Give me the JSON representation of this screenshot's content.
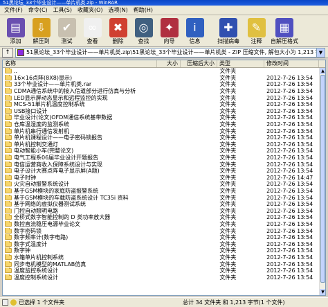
{
  "window": {
    "title": "51黑论坛_33个毕业设计——单片机类.zip - WinRAR"
  },
  "menu": [
    "文件(F)",
    "命令(C)",
    "工具(S)",
    "收藏夹(O)",
    "选项(N)",
    "帮助(H)"
  ],
  "toolbar": [
    {
      "label": "添加",
      "icon": "add-books-icon",
      "color": "#6a4fb0"
    },
    {
      "label": "解压到",
      "icon": "extract-to-icon",
      "color": "#d8a020"
    },
    {
      "label": "测试",
      "icon": "test-check-icon",
      "color": "#c8c0b0"
    },
    {
      "label": "查看",
      "icon": "view-glasses-icon",
      "color": "#f0f0f0"
    },
    {
      "label": "删除",
      "icon": "delete-icon",
      "color": "#d04030"
    },
    {
      "label": "查找",
      "icon": "find-binoculars-icon",
      "color": "#406080"
    },
    {
      "label": "向导",
      "icon": "wizard-icon",
      "color": "#b03040"
    },
    {
      "label": "信息",
      "icon": "info-icon",
      "color": "#3060c0"
    },
    {
      "label": "扫描病毒",
      "icon": "virus-scan-icon",
      "color": "#3050b0"
    },
    {
      "label": "注释",
      "icon": "comment-icon",
      "color": "#e0c040"
    },
    {
      "label": "自解压格式",
      "icon": "sfx-icon",
      "color": "#5050c0"
    }
  ],
  "address": {
    "up_label": "↑",
    "path": "51黑论坛_33个毕业设计——单片机类.zip\\51黑论坛_33个毕业设计——单片机类 - ZIP 压缩文件, 解包大小为 1,213 字节"
  },
  "columns": {
    "name": "名称",
    "size": "大小",
    "packed": "压缩后大小",
    "type": "类型",
    "modified": "修改时间"
  },
  "files": [
    {
      "name": "..",
      "type": "文件夹",
      "modified": ""
    },
    {
      "name": "16×16点阵(8X8)显示)",
      "type": "文件夹",
      "modified": "2012-7-26 13:54"
    },
    {
      "name": "33个毕业设计——单片机类.rar",
      "type": "文件夹",
      "modified": "2012-7-26 13:54"
    },
    {
      "name": "CDMA通信系统中的接入信道部分进行仿真与分析",
      "type": "文件夹",
      "modified": "2012-7-26 13:54"
    },
    {
      "name": "LED显示屏动态显示和远程监控的实现",
      "type": "文件夹",
      "modified": "2012-7-26 13:54"
    },
    {
      "name": "MCS-51单片机温度控制系统",
      "type": "文件夹",
      "modified": "2012-7-26 13:54"
    },
    {
      "name": "USB接口设计",
      "type": "文件夹",
      "modified": "2012-7-26 13:54"
    },
    {
      "name": "毕业设计(论文)OFDM通信系统基带数据",
      "type": "文件夹",
      "modified": "2012-7-26 13:54"
    },
    {
      "name": "仓库温湿度的监测系统",
      "type": "文件夹",
      "modified": "2012-7-26 13:54"
    },
    {
      "name": "单片机串行通信发射机",
      "type": "文件夹",
      "modified": "2012-7-26 13:54"
    },
    {
      "name": "单片机课程设计——电子密码锁报告",
      "type": "文件夹",
      "modified": "2012-7-26 13:54"
    },
    {
      "name": "单片机控制交通灯",
      "type": "文件夹",
      "modified": "2012-7-26 13:54"
    },
    {
      "name": "电动智能小车(完整论文)",
      "type": "文件夹",
      "modified": "2012-7-26 13:54"
    },
    {
      "name": "电气工程系06届毕业设计开题报告",
      "type": "文件夹",
      "modified": "2012-7-26 13:54"
    },
    {
      "name": "电信运营商收入保障系统设计与实现",
      "type": "文件夹",
      "modified": "2012-7-26 13:54"
    },
    {
      "name": "电子设计大赛点阵电子显示屏(A题)",
      "type": "文件夹",
      "modified": "2012-7-26 13:54"
    },
    {
      "name": "电子时钟",
      "type": "文件夹",
      "modified": "2012-7-26 14:47"
    },
    {
      "name": "火灾自动报警系统设计",
      "type": "文件夹",
      "modified": "2012-7-26 13:54"
    },
    {
      "name": "基于GSM模块的家庭防盗报警系统",
      "type": "文件夹",
      "modified": "2012-7-26 13:54"
    },
    {
      "name": "基于GSM模块的车载防盗系统设计 TC35i 资料",
      "type": "文件夹",
      "modified": "2012-7-26 13:54"
    },
    {
      "name": "基于网络的虚拟仪器测试系统",
      "type": "文件夹",
      "modified": "2012-7-26 13:54"
    },
    {
      "name": "门控自动照明电路",
      "type": "文件夹",
      "modified": "2012-7-26 13:54"
    },
    {
      "name": "全桥式数字智能控制的 D 类功率放大器",
      "type": "文件夹",
      "modified": "2012-7-26 13:54"
    },
    {
      "name": "数控直流稳压电源毕业论文",
      "type": "文件夹",
      "modified": "2012-7-26 13:54"
    },
    {
      "name": "数字密码锁",
      "type": "文件夹",
      "modified": "2012-7-26 13:54"
    },
    {
      "name": "数字频率计(数字电路)",
      "type": "文件夹",
      "modified": "2012-7-26 13:54"
    },
    {
      "name": "数字式温度计",
      "type": "文件夹",
      "modified": "2012-7-26 13:54"
    },
    {
      "name": "数字钟",
      "type": "文件夹",
      "modified": "2012-7-26 13:54"
    },
    {
      "name": "水箱单片机控制系统",
      "type": "文件夹",
      "modified": "2012-7-26 13:54"
    },
    {
      "name": "同步电机模型的MATLAB仿真",
      "type": "文件夹",
      "modified": "2012-7-26 13:54"
    },
    {
      "name": "温度监控系统设计",
      "type": "文件夹",
      "modified": "2012-7-26 13:54"
    },
    {
      "name": "温度控制系统设计",
      "type": "文件夹",
      "modified": "2012-7-26 13:54"
    }
  ],
  "status": {
    "left": "已选择 1 个文件夹",
    "right": "总计 34 文件夹 和 1,213 字节(1 个文件)"
  }
}
